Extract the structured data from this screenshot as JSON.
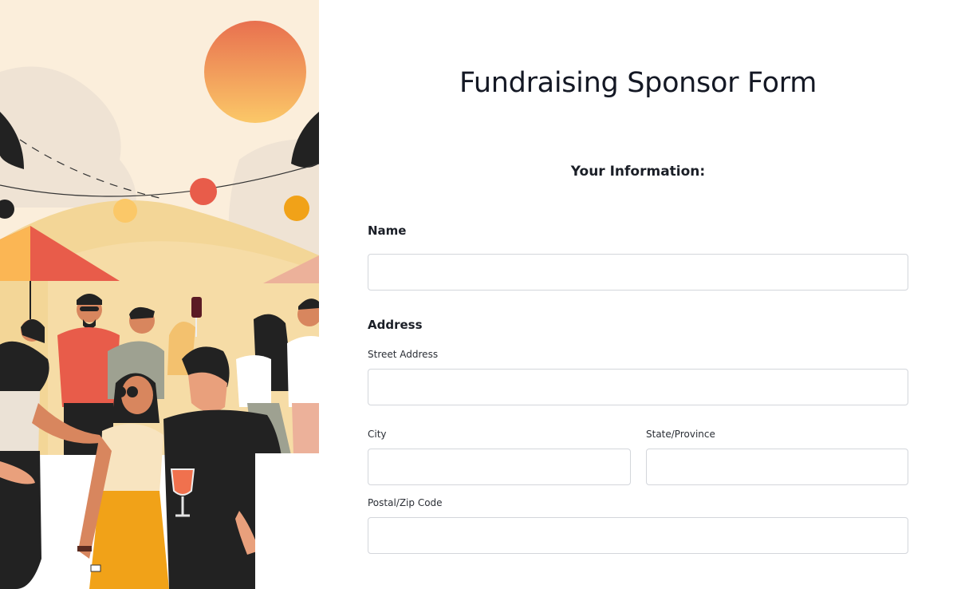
{
  "form": {
    "title": "Fundraising Sponsor Form",
    "section_heading": "Your Information:",
    "name": {
      "label": "Name",
      "value": "",
      "placeholder": ""
    },
    "address": {
      "label": "Address",
      "street_label": "Street Address",
      "street_value": "",
      "city_label": "City",
      "city_value": "",
      "state_label": "State/Province",
      "state_value": "",
      "postal_label": "Postal/Zip Code",
      "postal_value": ""
    }
  },
  "illustration": {
    "icon": "festival-crowd-illustration",
    "colors": {
      "sky": "#fbeedb",
      "sun": "#f0905a",
      "hills": "#f3d697",
      "umbrella": "#e85c4a",
      "dark": "#222222",
      "skirt": "#f1a218"
    }
  },
  "colors": {
    "input_border": "#d3d6db",
    "text": "#1b1f27",
    "background": "#ffffff"
  }
}
